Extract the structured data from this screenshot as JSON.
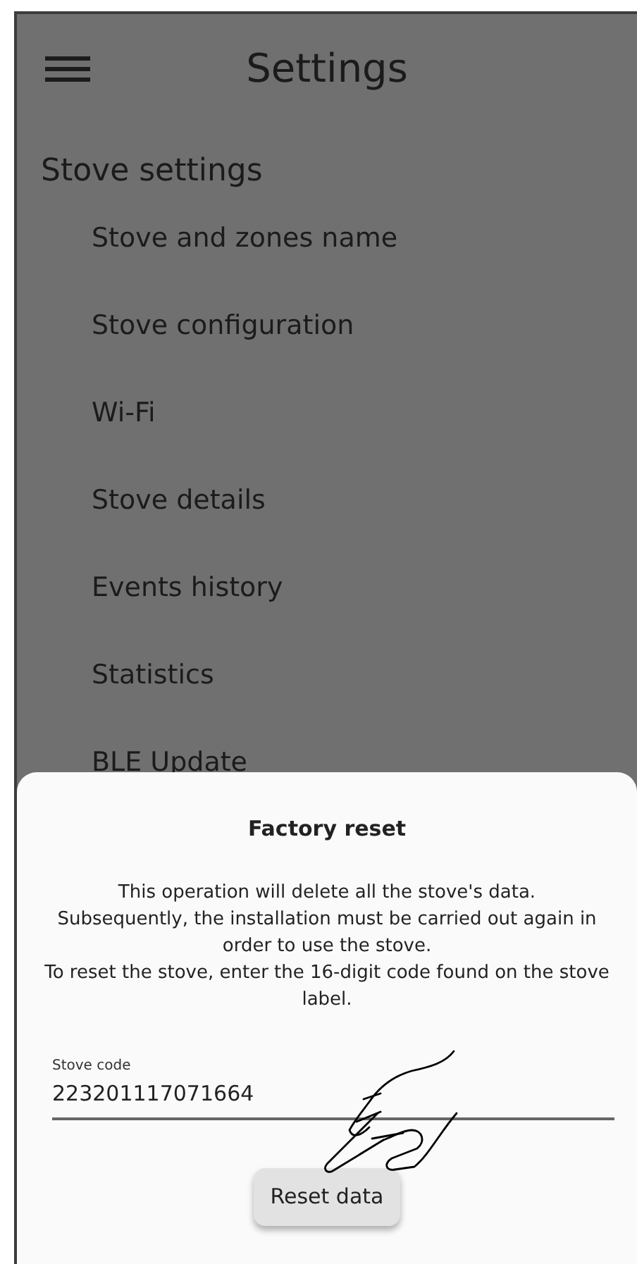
{
  "app_bar": {
    "title": "Settings"
  },
  "section": {
    "title": "Stove settings",
    "items": [
      {
        "label": "Stove and zones name"
      },
      {
        "label": "Stove configuration"
      },
      {
        "label": "Wi-Fi"
      },
      {
        "label": "Stove details"
      },
      {
        "label": "Events history"
      },
      {
        "label": "Statistics"
      },
      {
        "label": "BLE Update"
      }
    ]
  },
  "sheet": {
    "title": "Factory reset",
    "message": [
      "This operation will delete all the stove's data.",
      "Subsequently, the installation must be carried out again in order to use the stove.",
      "To reset the stove, enter the 16-digit code found on the stove label."
    ],
    "field": {
      "label": "Stove code",
      "value": "223201117071664"
    },
    "button": "Reset data"
  }
}
